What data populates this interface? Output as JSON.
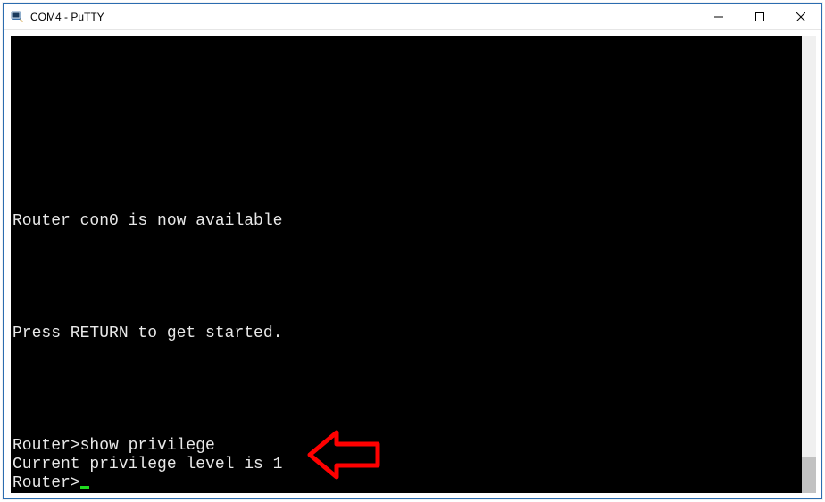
{
  "window": {
    "title": "COM4 - PuTTY"
  },
  "terminal": {
    "lines": [
      "",
      "",
      "",
      "",
      "",
      "",
      "",
      "",
      "Router con0 is now available",
      "",
      "",
      "",
      "",
      "",
      "Press RETURN to get started.",
      "",
      "",
      "",
      "",
      "",
      "Router>show privilege",
      "Current privilege level is 1",
      "Router>"
    ],
    "prompt": "Router>",
    "last_command": "show privilege",
    "last_output": "Current privilege level is 1"
  },
  "annotation": {
    "type": "arrow",
    "color": "#ff0000",
    "points_to": "Current privilege level is 1"
  }
}
